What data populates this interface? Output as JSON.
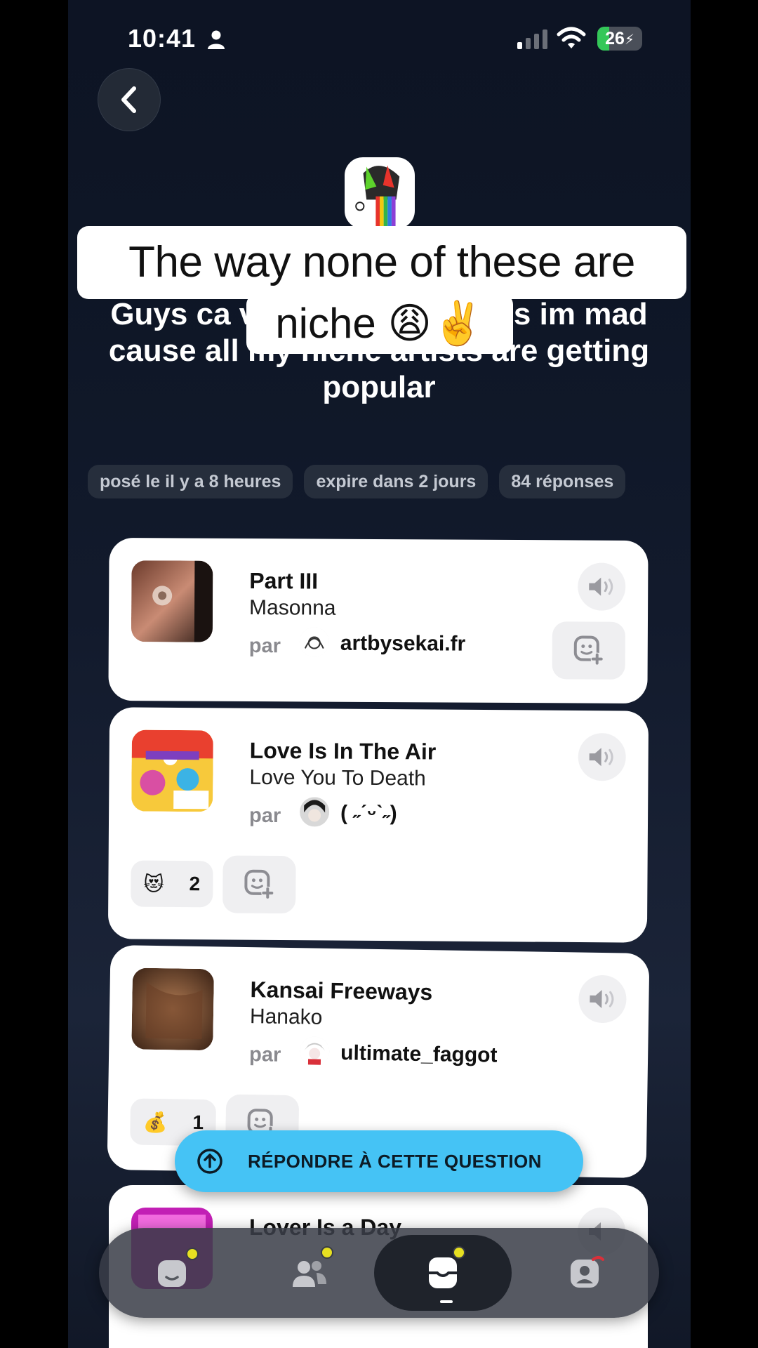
{
  "status_bar": {
    "time": "10:41",
    "battery": "26",
    "battery_level": 0.26
  },
  "header": {
    "back_label": "Back"
  },
  "question": {
    "text": "Guys ca      vourite niche songs im mad cause all my niche artists are getting popular",
    "overlay_line1": "The way none of these are",
    "overlay_line2": "niche 😩✌️"
  },
  "meta": [
    {
      "label": "posé le il y a 8 heures"
    },
    {
      "label": "expire dans 2 jours"
    },
    {
      "label": "84 réponses"
    }
  ],
  "answers": [
    {
      "title": "Part III",
      "artist": "Masonna",
      "by_label": "par",
      "username": "artbysekai.fr",
      "reaction_emoji": "",
      "reaction_count": ""
    },
    {
      "title": "Love Is In The Air",
      "artist": "Love You To Death",
      "by_label": "par",
      "username": "( ˶ˊᵕˋ˶)",
      "reaction_emoji": "😻",
      "reaction_count": "2"
    },
    {
      "title": "Kansai Freeways",
      "artist": "Hanako",
      "by_label": "par",
      "username": "ultimate_faggot",
      "reaction_emoji": "💰",
      "reaction_count": "1"
    },
    {
      "title": "Lover Is a Day",
      "artist": "",
      "by_label": "",
      "username": "",
      "reaction_emoji": "",
      "reaction_count": ""
    }
  ],
  "cta": {
    "label": "RÉPONDRE À CETTE QUESTION"
  },
  "colors": {
    "accent": "#45c3f5",
    "notification_dot": "#e7e021",
    "background": "#0e1626"
  }
}
